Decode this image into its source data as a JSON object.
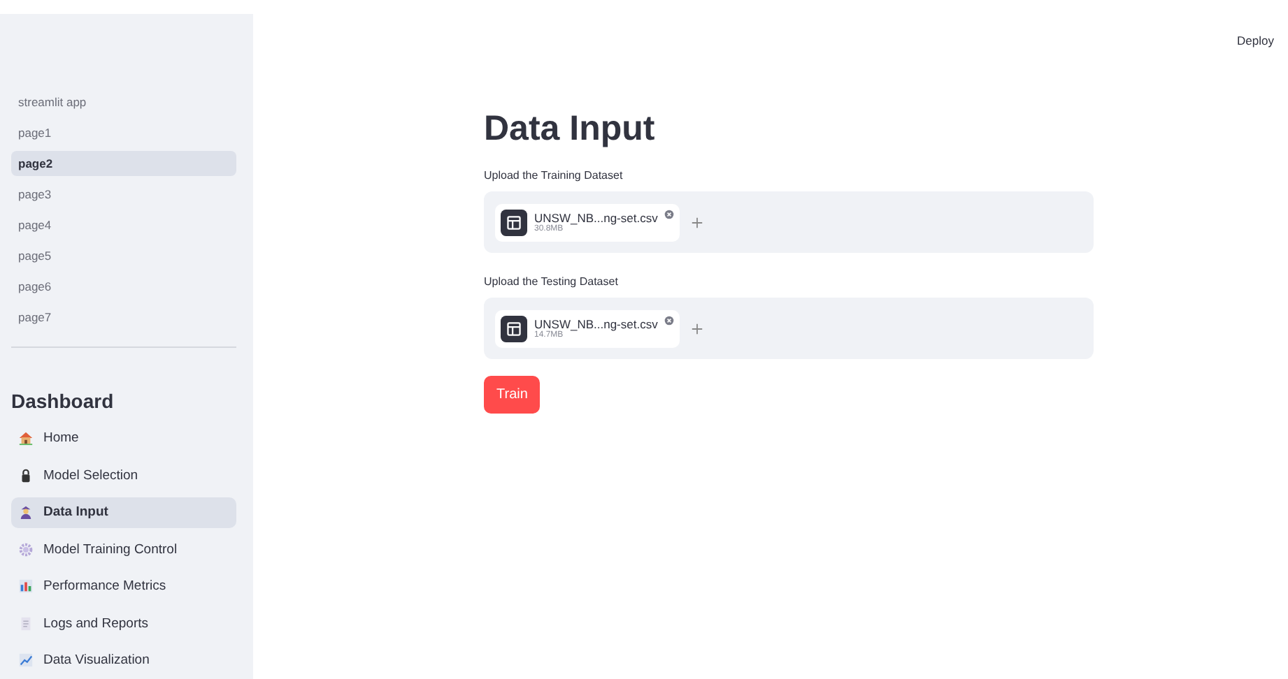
{
  "header": {
    "deploy": "Deploy"
  },
  "sidebar": {
    "pages": [
      {
        "label": "streamlit app",
        "selected": false
      },
      {
        "label": "page1",
        "selected": false
      },
      {
        "label": "page2",
        "selected": true
      },
      {
        "label": "page3",
        "selected": false
      },
      {
        "label": "page4",
        "selected": false
      },
      {
        "label": "page5",
        "selected": false
      },
      {
        "label": "page6",
        "selected": false
      },
      {
        "label": "page7",
        "selected": false
      }
    ],
    "title": "Dashboard",
    "items": [
      {
        "label": "Home",
        "kind": "home",
        "selected": false
      },
      {
        "label": "Model Selection",
        "kind": "lock",
        "selected": false
      },
      {
        "label": "Data Input",
        "kind": "person",
        "selected": true
      },
      {
        "label": "Model Training Control",
        "kind": "gear",
        "selected": false
      },
      {
        "label": "Performance Metrics",
        "kind": "bars",
        "selected": false
      },
      {
        "label": "Logs and Reports",
        "kind": "document",
        "selected": false
      },
      {
        "label": "Data Visualization",
        "kind": "trend",
        "selected": false
      }
    ]
  },
  "main": {
    "title": "Data Input",
    "uploads": [
      {
        "label": "Upload the Training Dataset",
        "file": "UNSW_NB...ng-set.csv",
        "size": "30.8MB"
      },
      {
        "label": "Upload the Testing Dataset",
        "file": "UNSW_NB...ng-set.csv",
        "size": "14.7MB"
      }
    ],
    "button": "Train"
  }
}
